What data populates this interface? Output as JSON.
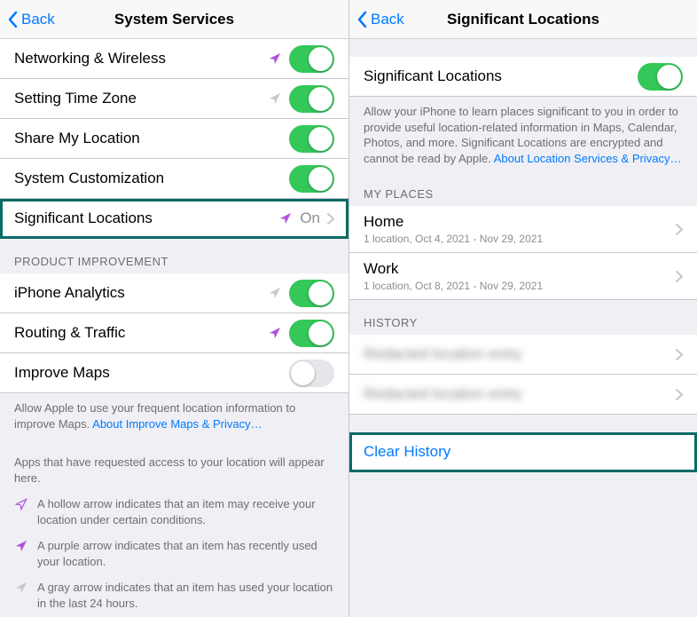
{
  "left": {
    "back": "Back",
    "title": "System Services",
    "rows": [
      {
        "label": "Networking & Wireless",
        "arrow": "purple",
        "toggle": true
      },
      {
        "label": "Setting Time Zone",
        "arrow": "gray",
        "toggle": true
      },
      {
        "label": "Share My Location",
        "arrow": null,
        "toggle": true
      },
      {
        "label": "System Customization",
        "arrow": null,
        "toggle": true
      },
      {
        "label": "Significant Locations",
        "arrow": "purple",
        "status": "On",
        "chevron": true
      }
    ],
    "section_product": "PRODUCT IMPROVEMENT",
    "rows2": [
      {
        "label": "iPhone Analytics",
        "arrow": "gray",
        "toggle": true
      },
      {
        "label": "Routing & Traffic",
        "arrow": "purple",
        "toggle": true
      },
      {
        "label": "Improve Maps",
        "arrow": null,
        "toggle": false
      }
    ],
    "footer_maps": "Allow Apple to use your frequent location information to improve Maps. ",
    "footer_maps_link": "About Improve Maps & Privacy…",
    "footer_apps": "Apps that have requested access to your location will appear here.",
    "legend_hollow": "A hollow arrow indicates that an item may receive your location under certain conditions.",
    "legend_purple": "A purple arrow indicates that an item has recently used your location.",
    "legend_gray": "A gray arrow indicates that an item has used your location in the last 24 hours."
  },
  "right": {
    "back": "Back",
    "title": "Significant Locations",
    "toggle_label": "Significant Locations",
    "toggle_on": true,
    "desc": "Allow your iPhone to learn places significant to you in order to provide useful location-related information in Maps, Calendar, Photos, and more. Significant Locations are encrypted and cannot be read by Apple. ",
    "desc_link": "About Location Services & Privacy…",
    "section_myplaces": "MY PLACES",
    "places": [
      {
        "label": "Home",
        "sub": "1 location, Oct 4, 2021 - Nov 29, 2021"
      },
      {
        "label": "Work",
        "sub": "1 location, Oct 8, 2021 - Nov 29, 2021"
      }
    ],
    "section_history": "HISTORY",
    "history_blur1": "Redacted location entry",
    "history_blur2": "Redacted location entry",
    "clear_history": "Clear History"
  }
}
